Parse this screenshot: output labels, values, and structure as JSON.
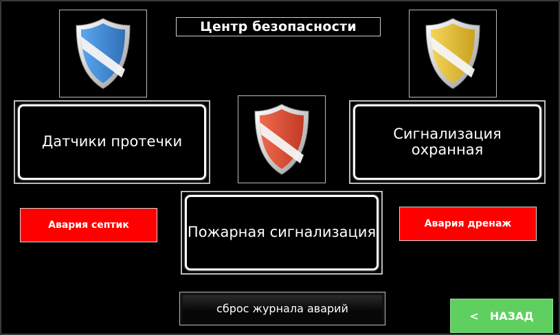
{
  "title": "Центр безопасности",
  "buttons": {
    "leak_sensors": "Датчики протечки",
    "security_alarm": "Сигнализация охранная",
    "fire_alarm": "Пожарная сигнализация",
    "reset_log": "сброс журнала аварий",
    "back_arrow": "<",
    "back_label": "НАЗАД"
  },
  "alarms": {
    "septic": "Авария септик",
    "drainage": "Авария дренаж"
  },
  "shields": {
    "left": {
      "icon": "blue-shield-icon",
      "color": "#3f8fe0"
    },
    "center": {
      "icon": "red-shield-icon",
      "color": "#e0533a"
    },
    "right": {
      "icon": "yellow-shield-icon",
      "color": "#e8c53a"
    }
  },
  "colors": {
    "background": "#000000",
    "alarm_red": "#ff0000",
    "back_green": "#5fcf5f"
  }
}
